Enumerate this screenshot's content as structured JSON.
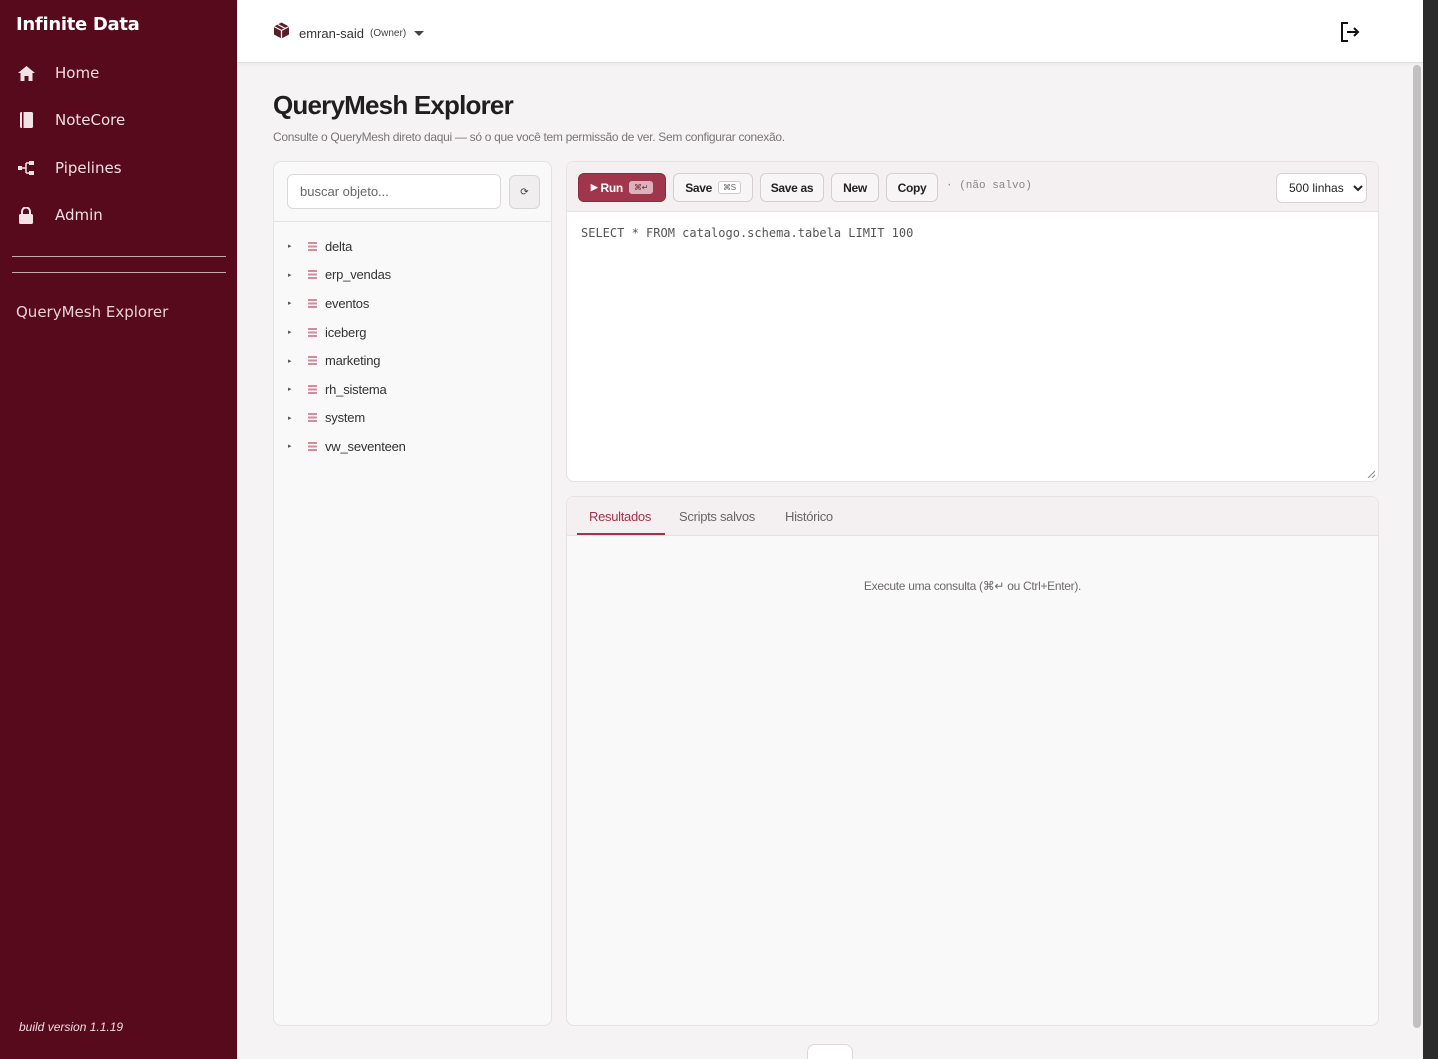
{
  "sidebar": {
    "brand": "Infinite Data",
    "items": [
      {
        "label": "Home",
        "icon": "home-icon"
      },
      {
        "label": "NoteCore",
        "icon": "book-icon"
      },
      {
        "label": "Pipelines",
        "icon": "flow-icon"
      },
      {
        "label": "Admin",
        "icon": "lock-icon"
      }
    ],
    "section_link": "QueryMesh Explorer",
    "build_version": "build version 1.1.19"
  },
  "topbar": {
    "org_name": "emran-said",
    "org_role": "(Owner)"
  },
  "page": {
    "title": "QueryMesh Explorer",
    "subtitle": "Consulte o QueryMesh direto daqui — só o que você tem permissão de ver. Sem configurar conexão."
  },
  "object_browser": {
    "search_placeholder": "buscar objeto...",
    "refresh_icon": "⟳",
    "catalogs": [
      "delta",
      "erp_vendas",
      "eventos",
      "iceberg",
      "marketing",
      "rh_sistema",
      "system",
      "vw_seventeen"
    ]
  },
  "editor": {
    "run_label": "Run",
    "run_shortcut": "⌘↵",
    "save_label": "Save",
    "save_shortcut": "⌘S",
    "save_as_label": "Save as",
    "new_label": "New",
    "copy_label": "Copy",
    "status": "· (não salvo)",
    "limit_options": [
      "500 linhas"
    ],
    "limit_selected": "500 linhas",
    "query": "SELECT * FROM catalogo.schema.tabela LIMIT 100"
  },
  "results": {
    "tabs": [
      "Resultados",
      "Scripts salvos",
      "Histórico"
    ],
    "active_tab": "Resultados",
    "empty_message": "Execute uma consulta (⌘↵ ou Ctrl+Enter)."
  },
  "colors": {
    "sidebar_bg": "#560a1c",
    "accent": "#a0364c",
    "catalog_icon": "#d38c9c"
  }
}
